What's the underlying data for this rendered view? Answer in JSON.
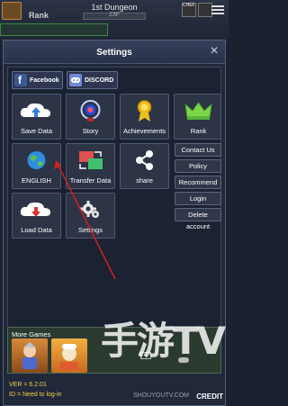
{
  "game": {
    "rank_label": "Rank",
    "dungeon_title": "1st Dungeon",
    "floor": "23F",
    "corner_label": "CHEF"
  },
  "dialog": {
    "title": "Settings",
    "close_symbol": "×"
  },
  "social": [
    {
      "label": "Facebook",
      "icon": "facebook-icon",
      "color": "#3b5998"
    },
    {
      "label": "DISCORD",
      "icon": "discord-icon",
      "color": "#7289da"
    }
  ],
  "tiles": [
    {
      "label": "Save Data",
      "icon": "cloud-upload-icon"
    },
    {
      "label": "Story",
      "icon": "story-portal-icon"
    },
    {
      "label": "Achievements",
      "icon": "medal-icon"
    },
    {
      "label": "Rank",
      "icon": "crown-icon"
    },
    {
      "label": "ENGLISH",
      "icon": "globe-icon"
    },
    {
      "label": "Transfer Data",
      "icon": "transfer-icon"
    },
    {
      "label": "share",
      "icon": "share-icon"
    },
    {
      "label": "Load Data",
      "icon": "cloud-download-icon"
    },
    {
      "label": "Settings",
      "icon": "gear-icon"
    }
  ],
  "side_buttons": [
    "Contact Us",
    "Policy",
    "Recommend",
    "Login",
    "Delete account"
  ],
  "more_games": {
    "label": "More Games",
    "thumbs": [
      "game-thumb-knight",
      "game-thumb-chef"
    ]
  },
  "footer": {
    "version": "VER = 6.2.01",
    "id_text": "ID = Need to log-in",
    "credit": "CREDIT"
  },
  "watermark": {
    "big": "手游TV",
    "small": "SHOUYOUTV.COM"
  },
  "colors": {
    "accent": "#f2d64a",
    "annotation": "#d32020"
  }
}
